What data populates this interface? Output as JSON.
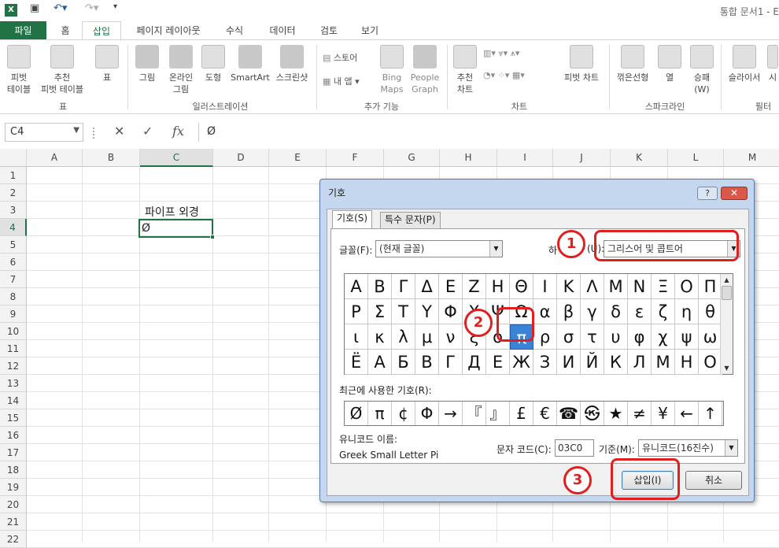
{
  "app": {
    "title": "통합 문서1 - E",
    "quick_access": [
      "excel-icon",
      "save-icon",
      "undo-icon",
      "redo-icon",
      "customize-icon"
    ]
  },
  "tabs": {
    "file": "파일",
    "items": [
      "홈",
      "삽입",
      "페이지 레이아웃",
      "수식",
      "데이터",
      "검토",
      "보기"
    ],
    "active": "삽입"
  },
  "ribbon": {
    "pivot_table": "피벗\n테이블",
    "recommended_pivot": "추천\n피벗 테이블",
    "table": "표",
    "group_tables": "표",
    "picture": "그림",
    "online_picture": "온라인\n그림",
    "shapes": "도형",
    "smartart": "SmartArt",
    "screenshot": "스크린샷",
    "group_illustrations": "일러스트레이션",
    "store": "스토어",
    "my_apps": "내 앱",
    "bing_maps": "Bing\nMaps",
    "people_graph": "People\nGraph",
    "group_addins": "추가 기능",
    "recommended_chart": "추천\n차트",
    "pivot_chart": "피벗 차트",
    "group_charts": "차트",
    "sparkline_line": "꺾은선형",
    "sparkline_column": "열",
    "sparkline_winloss": "승패\n(W)",
    "group_sparklines": "스파크라인",
    "slicer": "슬라이서",
    "timeline": "시",
    "group_filters": "필터"
  },
  "formula_bar": {
    "name_box": "C4",
    "cancel_glyph": "✕",
    "enter_glyph": "✓",
    "fx_glyph": "fx",
    "content": "Ø"
  },
  "grid": {
    "columns": [
      "A",
      "B",
      "C",
      "D",
      "E",
      "F",
      "G",
      "H",
      "I",
      "J",
      "K",
      "L",
      "M"
    ],
    "rows": [
      "1",
      "2",
      "3",
      "4",
      "5",
      "6",
      "7",
      "8",
      "9",
      "10",
      "11",
      "12",
      "13",
      "14",
      "15",
      "16",
      "17",
      "18",
      "19",
      "20",
      "21",
      "22"
    ],
    "selected_column": "C",
    "selected_row": "4",
    "cells": {
      "C3": "파이프 외경",
      "C4": "Ø"
    }
  },
  "dialog": {
    "title": "기호",
    "help": "?",
    "close": "✕",
    "tab_symbols": "기호(S)",
    "tab_special": "특수 문자(P)",
    "font_label": "글꼴(F):",
    "font_value": "(현재 글꼴)",
    "subset_label": "하",
    "subset_label_tail": "(U):",
    "subset_value": "그리스어 및 콥트어",
    "symbols": [
      [
        "Α",
        "Β",
        "Γ",
        "Δ",
        "Ε",
        "Ζ",
        "Η",
        "Θ",
        "Ι",
        "Κ",
        "Λ",
        "Μ",
        "Ν",
        "Ξ",
        "Ο",
        "Π"
      ],
      [
        "Ρ",
        "Σ",
        "Τ",
        "Υ",
        "Φ",
        "Χ",
        "Ψ",
        "Ω",
        "α",
        "β",
        "γ",
        "δ",
        "ε",
        "ζ",
        "η",
        "θ"
      ],
      [
        "ι",
        "κ",
        "λ",
        "μ",
        "ν",
        "ξ",
        "ο",
        "π",
        "ρ",
        "σ",
        "τ",
        "υ",
        "φ",
        "χ",
        "ψ",
        "ω"
      ],
      [
        "Ё",
        "А",
        "Б",
        "В",
        "Г",
        "Д",
        "Е",
        "Ж",
        "З",
        "И",
        "Й",
        "К",
        "Л",
        "М",
        "Н",
        "О"
      ]
    ],
    "selected_symbol": "π",
    "recent_label": "최근에 사용한 기호(R):",
    "recent": [
      "Ø",
      "π",
      "¢",
      "Φ",
      "→",
      "『",
      "』",
      "£",
      "€",
      "☎",
      "㉿",
      "★",
      "≠",
      "¥",
      "←",
      "↑"
    ],
    "unicode_name_label": "유니코드 이름:",
    "unicode_name": "Greek Small Letter Pi",
    "char_code_label": "문자 코드(C):",
    "char_code": "03C0",
    "from_label": "기준(M):",
    "from_value": "유니코드(16진수)",
    "insert_button": "삽입(I)",
    "cancel_button": "취소"
  },
  "annotations": [
    "1",
    "2",
    "3"
  ],
  "colors": {
    "excel_green": "#217346",
    "annotation_red": "#e0201f",
    "selection_blue": "#3b83d6"
  }
}
